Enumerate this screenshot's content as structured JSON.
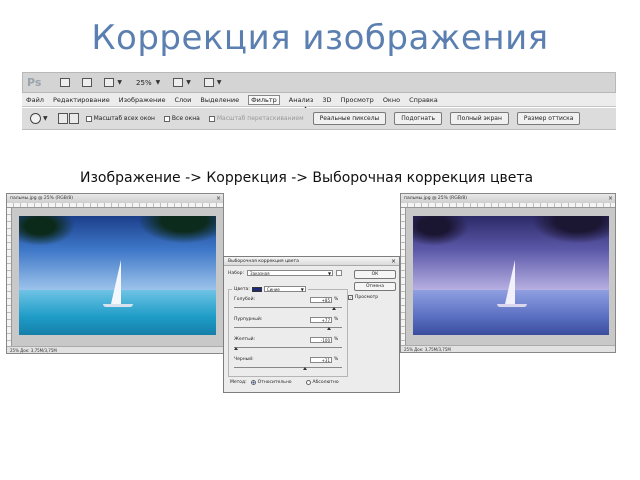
{
  "slide": {
    "title": "Коррекция изображения",
    "caption": "Изображение -> Коррекция -> Выборочная коррекция цвета"
  },
  "app_bar": {
    "logo": "Ps",
    "zoom": "25%"
  },
  "menu": {
    "items": [
      {
        "label": "Файл"
      },
      {
        "label": "Редактирование"
      },
      {
        "label": "Изображение"
      },
      {
        "label": "Слои"
      },
      {
        "label": "Выделение"
      },
      {
        "label": "Фильтр"
      },
      {
        "label": "Анализ"
      },
      {
        "label": "3D"
      },
      {
        "label": "Просмотр"
      },
      {
        "label": "Окно"
      },
      {
        "label": "Справка"
      }
    ],
    "active_index": 5
  },
  "options_bar": {
    "checkboxes": [
      {
        "label": "Масштаб всех окон",
        "enabled": true
      },
      {
        "label": "Все окна",
        "enabled": true
      },
      {
        "label": "Масштаб перетаскиванием",
        "enabled": false
      }
    ],
    "buttons": [
      "Реальные пикселы",
      "Подогнать",
      "Полный экран",
      "Размер оттиска"
    ]
  },
  "doc_before": {
    "title": "пальмы.jpg @ 25% (RGB/8)",
    "status": "25%   Док: 3,75M/3,75M"
  },
  "doc_after": {
    "title": "пальмы.jpg @ 25% (RGB/8)",
    "status": "25%   Док: 3,75M/3,75M"
  },
  "dialog": {
    "title": "Выборочная коррекция цвета",
    "preset_label": "Набор:",
    "preset_value": "Заказная",
    "colors_label": "Цвета:",
    "colors_value": "Синие",
    "ok_label": "ОК",
    "cancel_label": "Отмена",
    "preview_label": "Просмотр",
    "preview_checked": true,
    "sliders": [
      {
        "label": "Голубой:",
        "value": "+85",
        "percent": "%",
        "level": 0.92
      },
      {
        "label": "Пурпурный:",
        "value": "+77",
        "percent": "%",
        "level": 0.88
      },
      {
        "label": "Желтый:",
        "value": "-100",
        "percent": "%",
        "level": 0.0
      },
      {
        "label": "Черный:",
        "value": "+31",
        "percent": "%",
        "level": 0.65
      }
    ],
    "method_label": "Метод:",
    "method_relative": "Относительно",
    "method_absolute": "Абсолютно",
    "method_selected": "relative"
  }
}
